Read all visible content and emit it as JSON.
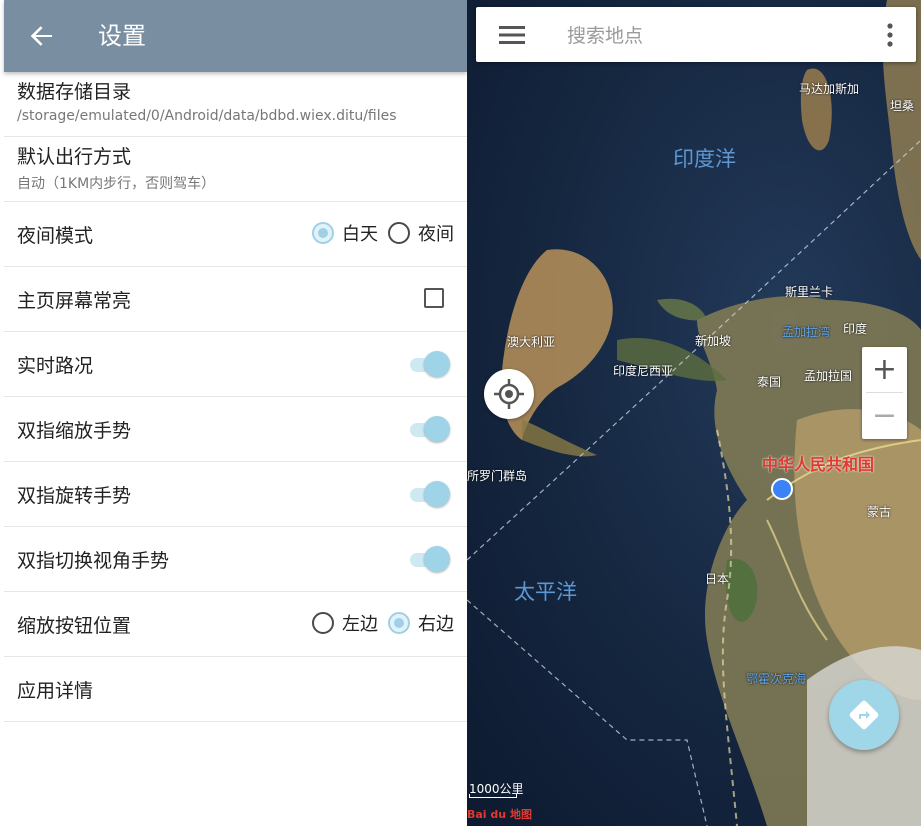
{
  "settings": {
    "title": "设置",
    "data_dir": {
      "label": "数据存储目录",
      "value": "/storage/emulated/0/Android/data/bdbd.wiex.ditu/files"
    },
    "travel_mode": {
      "label": "默认出行方式",
      "value": "自动（1KM内步行，否则驾车）"
    },
    "night_mode": {
      "label": "夜间模式",
      "options": [
        "白天",
        "夜间"
      ],
      "selected": "白天"
    },
    "keep_screen_on": {
      "label": "主页屏幕常亮",
      "checked": false
    },
    "realtime_traffic": {
      "label": "实时路况",
      "on": true
    },
    "two_finger_zoom": {
      "label": "双指缩放手势",
      "on": true
    },
    "two_finger_rotate": {
      "label": "双指旋转手势",
      "on": true
    },
    "two_finger_tilt": {
      "label": "双指切换视角手势",
      "on": true
    },
    "zoom_button_position": {
      "label": "缩放按钮位置",
      "options": [
        "左边",
        "右边"
      ],
      "selected": "右边"
    },
    "app_details": {
      "label": "应用详情"
    }
  },
  "map": {
    "search_placeholder": "搜索地点",
    "labels": {
      "indian_ocean": "印度洋",
      "pacific_ocean": "太平洋",
      "china": "中华人民共和国",
      "madagascar": "马达加斯加",
      "tanzania": "坦桑",
      "sri_lanka": "斯里兰卡",
      "bangladesh": "孟加拉湾",
      "india": "印度",
      "bangladesh_country": "孟加拉国",
      "australia": "澳大利亚",
      "singapore": "新加坡",
      "indonesia": "印度尼西亚",
      "thailand": "泰国",
      "solomon": "所罗门群岛",
      "mongolia": "蒙古",
      "japan": "日本",
      "okhotsk": "鄂霍次克海"
    },
    "scale_label": "1000公里",
    "logo_text": "Bai du 地图",
    "zoom_in": "+",
    "zoom_out": "−",
    "accent": "#9fd6e8",
    "appbar_color": "#7a8ea2"
  }
}
